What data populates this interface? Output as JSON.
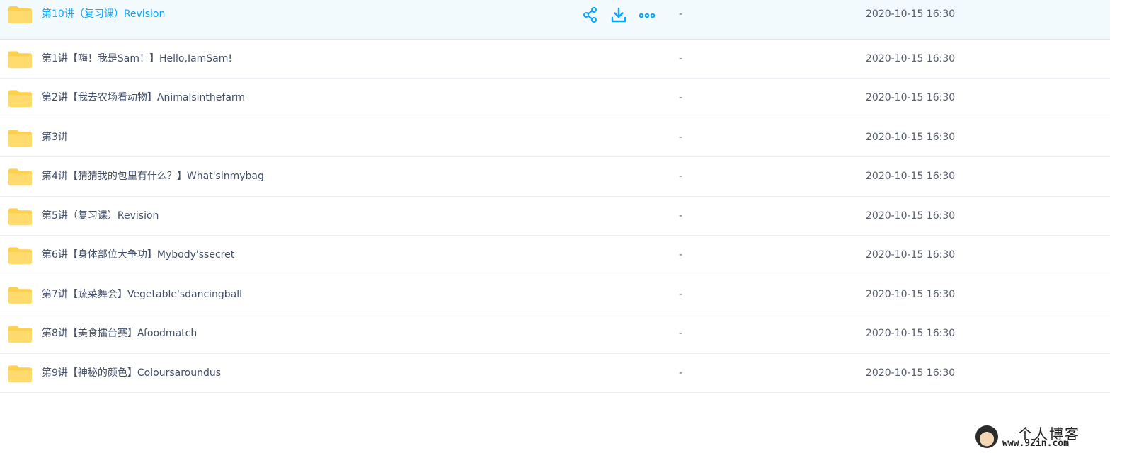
{
  "colors": {
    "accent": "#06a7ff",
    "folder": "#ffd04c",
    "highlight_bg": "#f2fafe"
  },
  "file_list": {
    "rows": [
      {
        "name": "第10讲（复习课）Revision",
        "size": "-",
        "date": "2020-10-15 16:30",
        "selected": true
      },
      {
        "name": "第1讲【嗨！我是Sam！】Hello,IamSam!",
        "size": "-",
        "date": "2020-10-15 16:30"
      },
      {
        "name": "第2讲【我去农场看动物】Animalsinthefarm",
        "size": "-",
        "date": "2020-10-15 16:30"
      },
      {
        "name": "第3讲",
        "size": "-",
        "date": "2020-10-15 16:30"
      },
      {
        "name": "第4讲【猜猜我的包里有什么？】What'sinmybag",
        "size": "-",
        "date": "2020-10-15 16:30"
      },
      {
        "name": "第5讲（复习课）Revision",
        "size": "-",
        "date": "2020-10-15 16:30"
      },
      {
        "name": "第6讲【身体部位大争功】Mybody'ssecret",
        "size": "-",
        "date": "2020-10-15 16:30"
      },
      {
        "name": "第7讲【蔬菜舞会】Vegetable'sdancingball",
        "size": "-",
        "date": "2020-10-15 16:30"
      },
      {
        "name": "第8讲【美食擂台赛】Afoodmatch",
        "size": "-",
        "date": "2020-10-15 16:30"
      },
      {
        "name": "第9讲【神秘的颜色】Coloursaroundus",
        "size": "-",
        "date": "2020-10-15 16:30"
      }
    ],
    "row_actions": [
      "share-icon",
      "download-icon",
      "more-icon"
    ]
  },
  "watermark": {
    "title": "个人博客",
    "url": "www.92in.com"
  }
}
